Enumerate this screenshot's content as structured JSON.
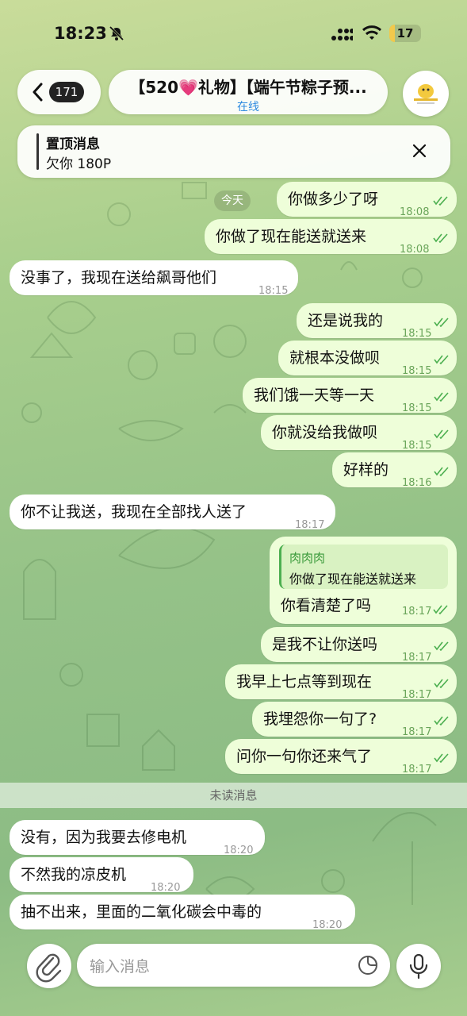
{
  "status_bar": {
    "time": "18:23",
    "battery": "17",
    "battery_level_percent": 17
  },
  "header": {
    "unread_count": "171",
    "title": "【520💗礼物】【端午节粽子预...",
    "status": "在线"
  },
  "pinned": {
    "title": "置顶消息",
    "text": "欠你 180P"
  },
  "date_chip": "今天",
  "messages": [
    {
      "text": "你做多少了呀",
      "time": "18:08"
    },
    {
      "text": "你做了现在能送就送来",
      "time": "18:08"
    },
    {
      "text": "没事了，我现在送给飙哥他们",
      "time": "18:15"
    },
    {
      "text": "还是说我的",
      "time": "18:15"
    },
    {
      "text": "就根本没做呗",
      "time": "18:15"
    },
    {
      "text": "我们饿一天等一天",
      "time": "18:15"
    },
    {
      "text": "你就没给我做呗",
      "time": "18:15"
    },
    {
      "text": "好样的",
      "time": "18:16"
    },
    {
      "text": "你不让我送，我现在全部找人送了",
      "time": "18:17"
    },
    {
      "reply_name": "肉肉肉",
      "reply_text": "你做了现在能送就送来",
      "text": "你看清楚了吗",
      "time": "18:17"
    },
    {
      "text": "是我不让你送吗",
      "time": "18:17"
    },
    {
      "text": "我早上七点等到现在",
      "time": "18:17"
    },
    {
      "text": "我埋怨你一句了?",
      "time": "18:17"
    },
    {
      "text": "问你一句你还来气了",
      "time": "18:17"
    },
    {
      "text": "没有，因为我要去修电机",
      "time": "18:20"
    },
    {
      "text": "不然我的凉皮机",
      "time": "18:20"
    },
    {
      "text": "抽不出来，里面的二氧化碳会中毒的",
      "time": "18:20"
    }
  ],
  "unread_divider": "未读消息",
  "input": {
    "placeholder": "输入消息"
  },
  "colors": {
    "outgoing_bubble": "#eefed9",
    "incoming_bubble": "#ffffff",
    "link_blue": "#2f8be0",
    "check_green": "#4caf50"
  },
  "icons": [
    "bell-slash-icon",
    "signal-icon",
    "wifi-icon",
    "back-chevron-icon",
    "close-icon",
    "double-check-icon",
    "paperclip-icon",
    "sticker-icon",
    "microphone-icon"
  ]
}
